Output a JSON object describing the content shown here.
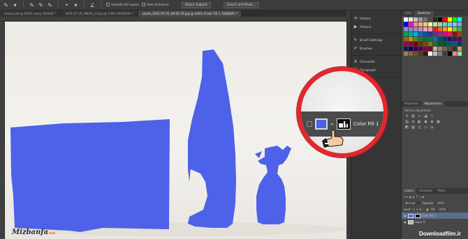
{
  "options_bar": {
    "sample_all_layers": "Sample All Layers",
    "auto_enhance": "Auto-Enhance",
    "select_subject": "Select Subject",
    "select_and_mask": "Select and Mask..."
  },
  "tabs": [
    {
      "label": "mown.psd @ 100% (easy,302b/8) *"
    },
    {
      "label": "2021-07-25_HMG4_23.jpg @ 100% (RGB/8#) *"
    },
    {
      "label": "photo_2021-07-25_09-52-25.jpg @ 100% (Color Fill 1, RGB/8#) *"
    }
  ],
  "dock": {
    "items": [
      "History",
      "Actions",
      "Brush Settings",
      "Brushes",
      "Character",
      "Paragraph",
      "3D"
    ]
  },
  "right_panel": {
    "tabs": [
      "Color",
      "Swatches"
    ],
    "adj_tabs": [
      "Properties",
      "Adjustments"
    ],
    "adj_title": "Add an adjustment",
    "layer_tabs": [
      "Layers",
      "Channels",
      "Paths"
    ],
    "blend_mode": "Normal",
    "opacity_label": "Opacity:",
    "opacity_value": "100%",
    "lock_label": "Lock:",
    "fill_label": "Fill:",
    "fill_value": "100%",
    "layer_1": "Color Fill 1",
    "layer_2": "Layer 0"
  },
  "callout": {
    "layer_name": "Color Fill 1"
  },
  "watermark": {
    "logo": "Mizbanfa",
    "suffix": "net"
  },
  "footer_brand": "Downloadfilm.ir",
  "colors": {
    "fill_blue": "#4d62e8",
    "callout_red": "#e3262d"
  },
  "swatches": [
    "#ffffff",
    "#e6e6e6",
    "#c6c6c6",
    "#9e9e9e",
    "#747474",
    "#4a4a4a",
    "#262626",
    "#000000",
    "#ff0000",
    "#ffff00",
    "#00ff00",
    "#00ffff",
    "#0000ff",
    "#ff00ff",
    "#f7977a",
    "#f9ad81",
    "#fdc68a",
    "#fff79a",
    "#c4df9b",
    "#a2d39c",
    "#82ca9d",
    "#7bcdc8",
    "#6ecff6",
    "#7ea7d8",
    "#8493ca",
    "#8882be",
    "#a187be",
    "#bc8dbf",
    "#f49ac2",
    "#f6989d",
    "#ed1c24",
    "#f26522",
    "#f7941d",
    "#fff200",
    "#8dc63f",
    "#39b54a",
    "#00a651",
    "#00a99d",
    "#00aeef",
    "#0072bc",
    "#0054a6",
    "#2e3192",
    "#662d91",
    "#92278f",
    "#ec008c",
    "#ed145b",
    "#9e0b0f",
    "#a0410d",
    "#a36209",
    "#aba000",
    "#598527",
    "#1a7b30",
    "#007236",
    "#00746b",
    "#0076a3",
    "#004b80",
    "#003471",
    "#1b1464",
    "#440e62",
    "#630460",
    "#9e005d",
    "#9e0039",
    "#790000",
    "#7b2e00",
    "#7d4900",
    "#827b00",
    "#406618",
    "#005e20",
    "#005826",
    "#005952",
    "#005b7f",
    "#003663",
    "#002157",
    "#0d004c",
    "#32004b",
    "#4b0049",
    "#7b0046",
    "#7a0026",
    "#c7b299",
    "#998675",
    "#736357",
    "#534741",
    "#37302d",
    "#c69c6d",
    "#a67c52",
    "#8c6239",
    "#754c24",
    "#603913",
    "#2d1b0e",
    "#ffffff",
    "#bfbfbf",
    "#808080",
    "#404040",
    "#000000",
    "#ff8080",
    "#80ff80"
  ]
}
